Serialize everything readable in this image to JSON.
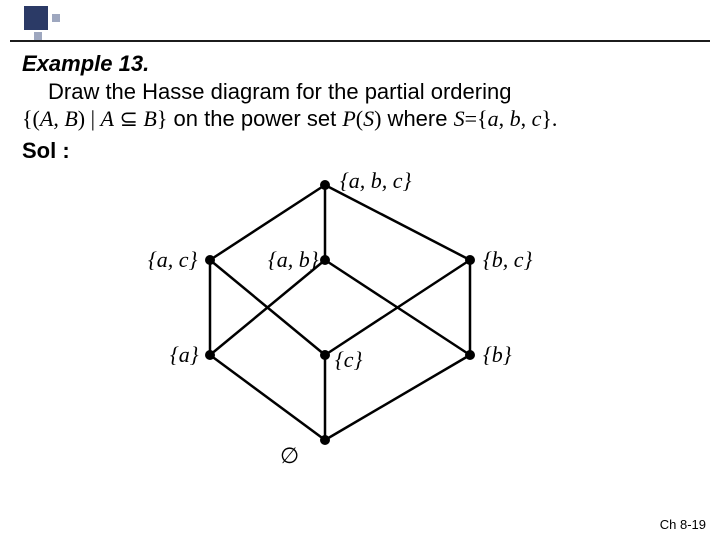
{
  "header": {
    "title": "Example 13."
  },
  "text": {
    "line1": "Draw the Hasse diagram for the partial ordering",
    "rel_open": "{(",
    "A": "A",
    "comma_sp": ", ",
    "B": "B",
    "rel_mid": ") | ",
    "A2": "A",
    "sub": " ⊆ ",
    "B2": "B",
    "rel_close": "}",
    "mid": " on the power set ",
    "P": "P",
    "paren_open": "(",
    "S": "S",
    "paren_close": ")",
    "where": " where ",
    "S2": "S",
    "eq": "=",
    "set_open": "{",
    "a": "a",
    "c1": ", ",
    "b": "b",
    "c2": ", ",
    "c": "c",
    "set_close": "}.",
    "sol": "Sol :"
  },
  "diagram": {
    "labels": {
      "top": "{a, b, c}",
      "ac": "{a, c}",
      "ab": "{a, b}",
      "bc": "{b, c}",
      "a": "{a}",
      "c": "{c}",
      "b": "{b}",
      "empty": "∅"
    }
  },
  "footer": {
    "page": "Ch 8-19"
  },
  "chart_data": {
    "type": "diagram",
    "title": "Hasse diagram of P({a,b,c}) ordered by subset",
    "nodes": [
      "∅",
      "{a}",
      "{b}",
      "{c}",
      "{a,b}",
      "{a,c}",
      "{b,c}",
      "{a,b,c}"
    ],
    "levels": {
      "0": [
        "∅"
      ],
      "1": [
        "{a}",
        "{c}",
        "{b}"
      ],
      "2": [
        "{a,c}",
        "{a,b}",
        "{b,c}"
      ],
      "3": [
        "{a,b,c}"
      ]
    },
    "edges": [
      [
        "∅",
        "{a}"
      ],
      [
        "∅",
        "{c}"
      ],
      [
        "∅",
        "{b}"
      ],
      [
        "{a}",
        "{a,c}"
      ],
      [
        "{a}",
        "{a,b}"
      ],
      [
        "{c}",
        "{a,c}"
      ],
      [
        "{c}",
        "{b,c}"
      ],
      [
        "{b}",
        "{a,b}"
      ],
      [
        "{b}",
        "{b,c}"
      ],
      [
        "{a,c}",
        "{a,b,c}"
      ],
      [
        "{a,b}",
        "{a,b,c}"
      ],
      [
        "{b,c}",
        "{a,b,c}"
      ]
    ]
  }
}
